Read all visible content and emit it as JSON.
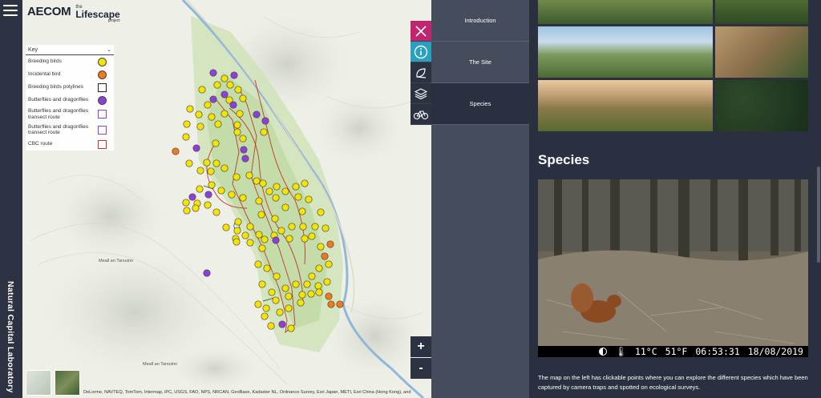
{
  "app": {
    "vertical_title": "Natural Capital Laboratory"
  },
  "logo": {
    "brand": "AECOM",
    "the": "the",
    "lifescape": "Lifescape",
    "project": "project"
  },
  "key": {
    "select_label": "Key",
    "items": [
      {
        "label": "Breeding birds",
        "symbol": "circle",
        "color": "#f5e400"
      },
      {
        "label": "Incidental bird",
        "symbol": "circle",
        "color": "#f07a1a"
      },
      {
        "label": "Breeding birds polylines",
        "symbol": "square",
        "color": "#222222"
      },
      {
        "label": "Butterflies and dragonflies",
        "symbol": "circle",
        "color": "#8f3fd9"
      },
      {
        "label": "Butterflies and dragonflies transect route",
        "symbol": "square",
        "color": "#8f3fd9"
      },
      {
        "label": "Butterflies and dragonflies transect route",
        "symbol": "square",
        "color": "#8f3fd9"
      },
      {
        "label": "CBC route",
        "symbol": "square",
        "color": "#c0392b"
      }
    ]
  },
  "map": {
    "places": [
      "Meall an Tarsuinn",
      "Meall an Tarsuinn"
    ],
    "attribution": "DeLorme, NAVTEQ, TomTom, Intermap, iPC, USGS, FAO, NPS, NRCAN, GeoBase, Kadaster NL, Ordnance Survey, Esri Japan, METI, Esri China (Hong Kong), and",
    "zoom_in": "+",
    "zoom_out": "-"
  },
  "icons": [
    {
      "name": "close-icon"
    },
    {
      "name": "info-icon"
    },
    {
      "name": "leaf-icon"
    },
    {
      "name": "layers-icon"
    },
    {
      "name": "bicycle-icon"
    }
  ],
  "nav": {
    "items": [
      {
        "label": "Introduction",
        "active": false
      },
      {
        "label": "The Site",
        "active": false
      },
      {
        "label": "Species",
        "active": true
      }
    ]
  },
  "content": {
    "heading": "Species",
    "camera": {
      "temp_c": "11°C",
      "temp_f": "51°F",
      "time": "06:53:31",
      "date": "18/08/2019"
    },
    "description": "The map on the left has clickable points where you can explore the different species which have been captured by camera traps and spotted on ecological surveys."
  },
  "colors": {
    "yellow": "#f5e400",
    "orange": "#f07a1a",
    "purple": "#8f3fd9",
    "route": "#c0392b",
    "accent_close": "#c0266d",
    "accent_info": "#2aa0c0"
  }
}
